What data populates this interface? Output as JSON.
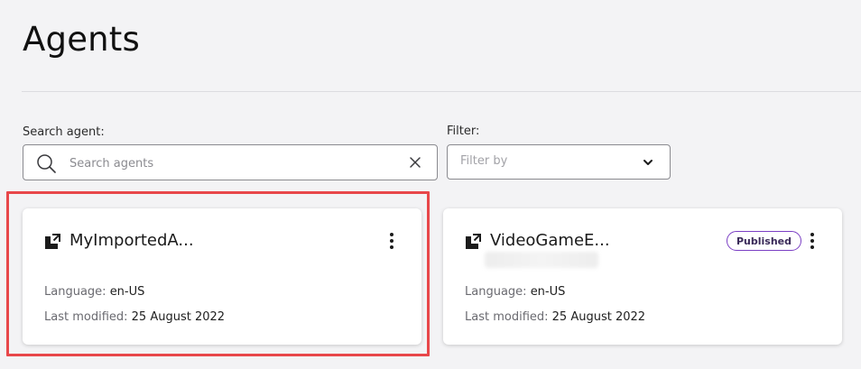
{
  "page": {
    "title": "Agents"
  },
  "search": {
    "label": "Search agent:",
    "placeholder": "Search agents",
    "value": ""
  },
  "filter": {
    "label": "Filter:",
    "placeholder": "Filter by"
  },
  "cards": [
    {
      "name": "MyImportedA...",
      "language_label": "Language:",
      "language": "en-US",
      "modified_label": "Last modified:",
      "modified": "25 August 2022",
      "highlighted": true
    },
    {
      "name": "VideoGameE...",
      "badge": "Published",
      "language_label": "Language:",
      "language": "en-US",
      "modified_label": "Last modified:",
      "modified": "25 August 2022"
    }
  ],
  "colors": {
    "background": "#f3f3f5",
    "highlight": "#e8474a",
    "badge_border": "#7b3fc4"
  },
  "icons": [
    "search-icon",
    "clear-icon",
    "chevron-down-icon",
    "agent-icon",
    "more-vertical-icon"
  ]
}
